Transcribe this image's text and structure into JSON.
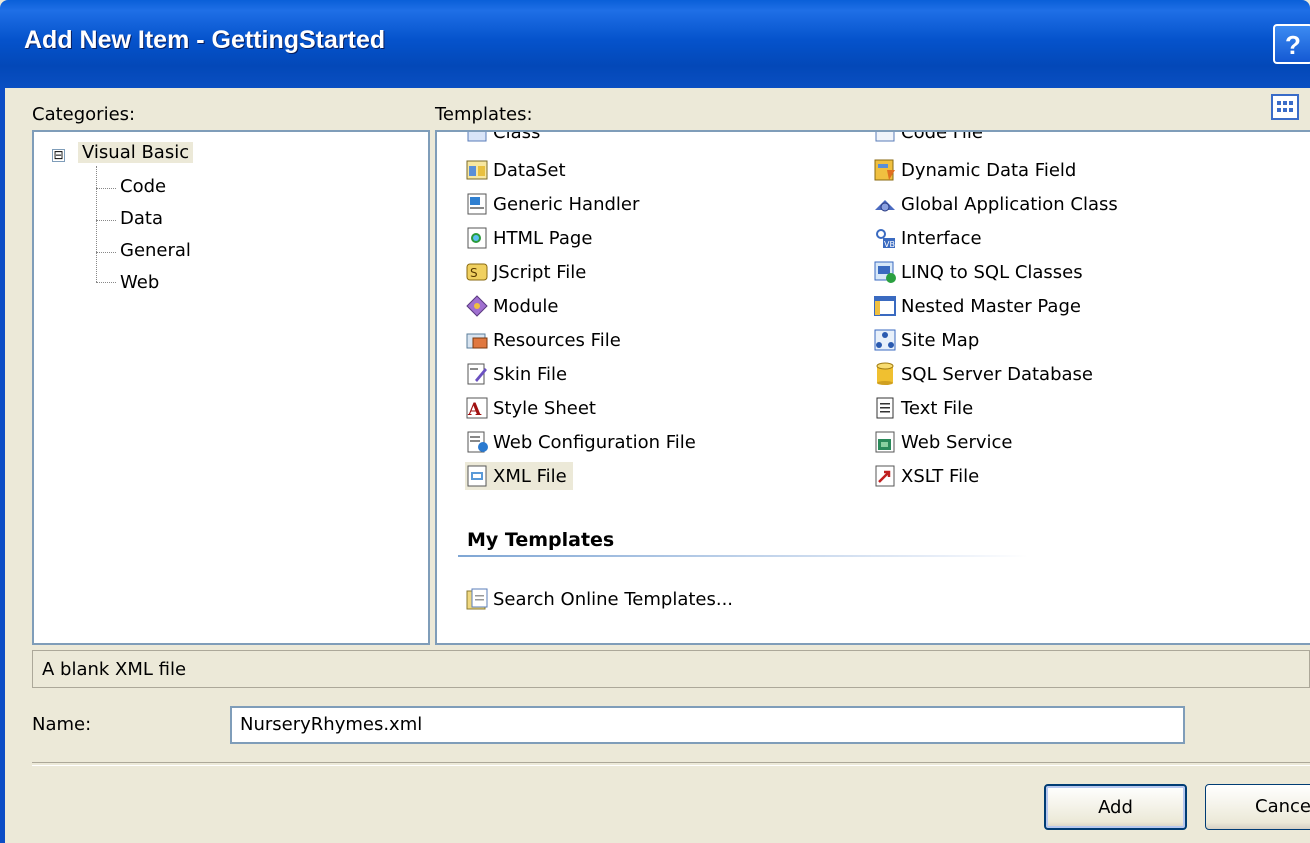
{
  "window": {
    "title": "Add New Item - GettingStarted",
    "help_label": "?"
  },
  "categories": {
    "label": "Categories:",
    "root": "Visual Basic",
    "expander": "⊟",
    "children": [
      "Code",
      "Data",
      "General",
      "Web"
    ]
  },
  "templates": {
    "label": "Templates:",
    "partial_top": [
      "Class",
      "Code File"
    ],
    "left": [
      "DataSet",
      "Generic Handler",
      "HTML Page",
      "JScript File",
      "Module",
      "Resources File",
      "Skin File",
      "Style Sheet",
      "Web Configuration File",
      "XML File"
    ],
    "right": [
      "Dynamic Data Field",
      "Global Application Class",
      "Interface",
      "LINQ to SQL Classes",
      "Nested Master Page",
      "Site Map",
      "SQL Server Database",
      "Text File",
      "Web Service",
      "XSLT File"
    ],
    "selected": "XML File",
    "my_templates_heading": "My Templates",
    "search_online": "Search Online Templates..."
  },
  "description": "A blank XML file",
  "name_field": {
    "label": "Name:",
    "value": "NurseryRhymes.xml"
  },
  "buttons": {
    "add": "Add",
    "cancel": "Cance"
  },
  "icons": [
    "help-icon",
    "view-grid-icon",
    "class-icon",
    "code-file-icon",
    "dataset-icon",
    "generic-handler-icon",
    "html-page-icon",
    "jscript-file-icon",
    "module-icon",
    "resources-file-icon",
    "skin-file-icon",
    "style-sheet-icon",
    "web-config-icon",
    "xml-file-icon",
    "dynamic-data-field-icon",
    "global-app-class-icon",
    "interface-icon",
    "linq-to-sql-icon",
    "nested-master-page-icon",
    "site-map-icon",
    "sql-database-icon",
    "text-file-icon",
    "web-service-icon",
    "xslt-file-icon",
    "search-online-icon"
  ],
  "colors": {
    "title_bar": "#0553cc",
    "selection": "#ece9d8",
    "border": "#7f9db9",
    "dialog_bg": "#ece9d8"
  }
}
